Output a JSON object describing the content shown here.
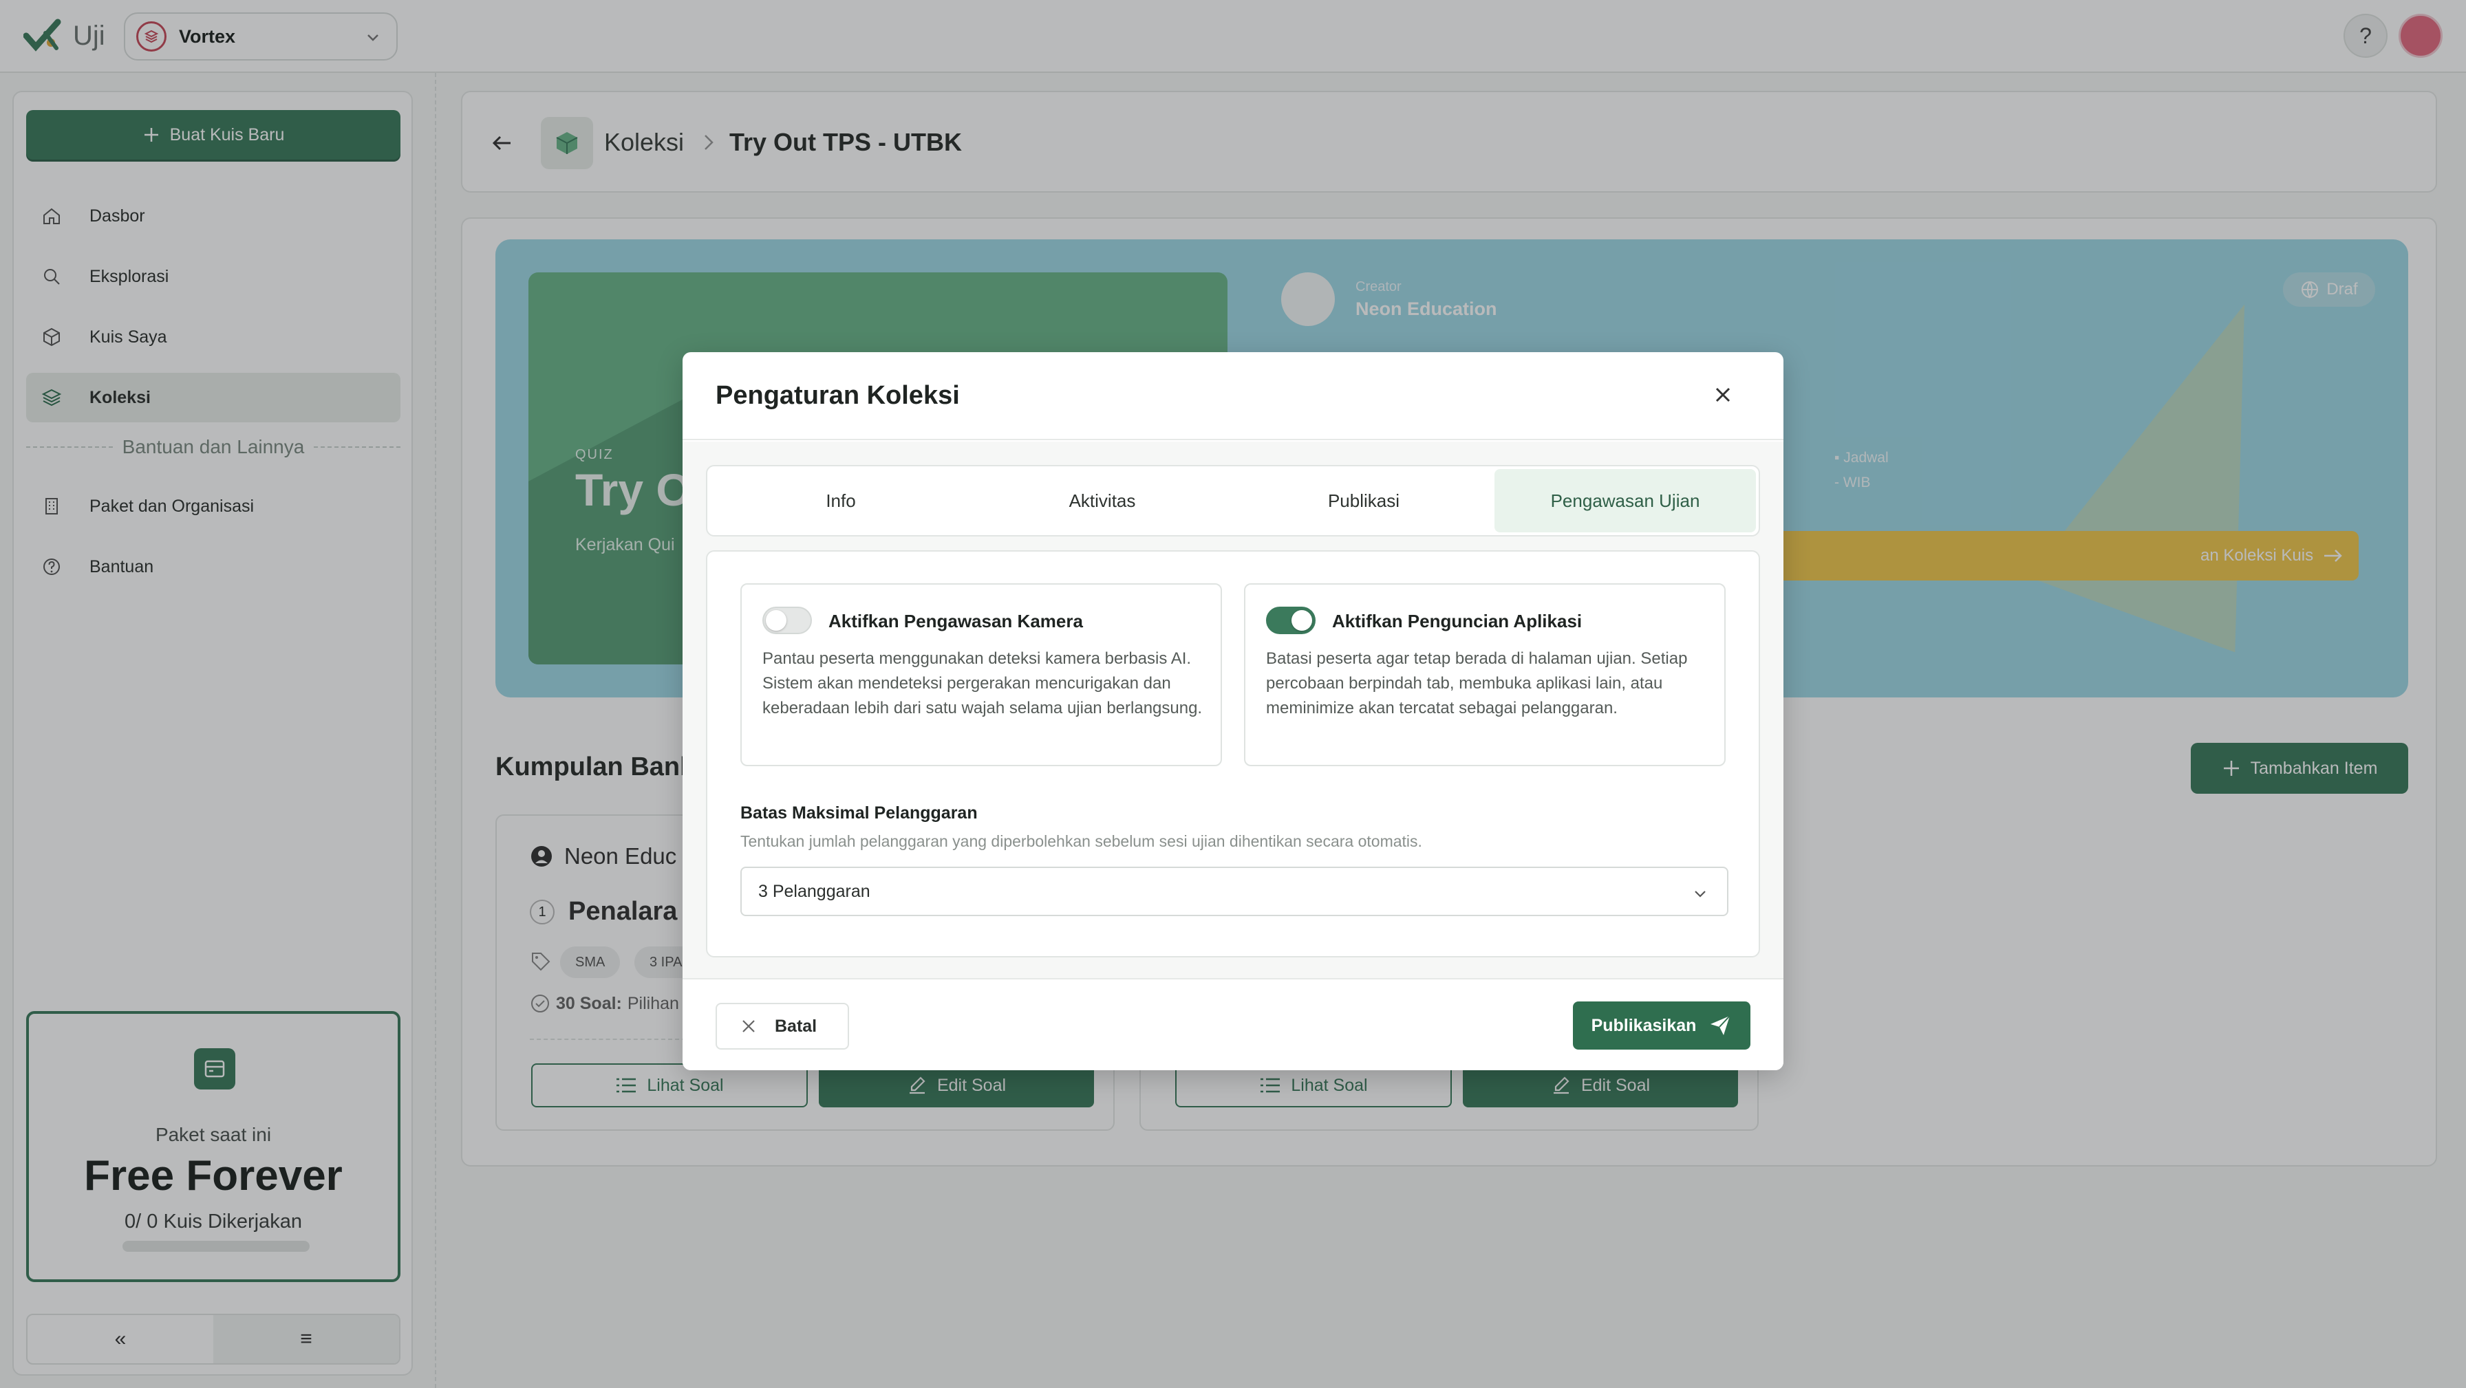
{
  "app": {
    "name": "Uji",
    "workspace": "Vortex"
  },
  "topbar": {
    "help_label": "?"
  },
  "sidebar": {
    "new_quiz": "Buat Kuis Baru",
    "items": [
      {
        "label": "Dasbor",
        "icon": "home-icon"
      },
      {
        "label": "Eksplorasi",
        "icon": "search-icon"
      },
      {
        "label": "Kuis Saya",
        "icon": "box-icon"
      },
      {
        "label": "Koleksi",
        "icon": "layers-icon",
        "active": true
      }
    ],
    "section_label": "Bantuan dan Lainnya",
    "extra_items": [
      {
        "label": "Paket dan Organisasi",
        "icon": "building-icon"
      },
      {
        "label": "Bantuan",
        "icon": "help-circle-icon"
      }
    ],
    "plan": {
      "label": "Paket saat ini",
      "name": "Free Forever",
      "count": "0/ 0 Kuis Dikerjakan",
      "progress": 0
    },
    "footer": {
      "collapse": "«",
      "menu": "≡"
    }
  },
  "breadcrumb": {
    "parent": "Koleksi",
    "current": "Try Out TPS - UTBK"
  },
  "hero": {
    "tag": "QUIZ",
    "title": "Try O",
    "subtitle": "Kerjakan Qui",
    "creator_label": "Creator",
    "creator_name": "Neon Education",
    "status": "Draf",
    "schedule_label": "Jadwal",
    "schedule_value": "- WIB",
    "cta": "an Koleksi Kuis"
  },
  "bank_section": {
    "title": "Kumpulan Bank",
    "add_label": "Tambahkan Item",
    "cards": [
      {
        "owner": "Neon Educ",
        "num": "1",
        "name": "Penalara",
        "tags": [
          "SMA",
          "3 IPA"
        ],
        "count": "30 Soal:",
        "type": "Pilihan",
        "view": "Lihat Soal",
        "edit": "Edit Soal"
      },
      {
        "view": "Lihat Soal",
        "edit": "Edit Soal"
      }
    ]
  },
  "modal": {
    "title": "Pengaturan Koleksi",
    "tabs": [
      "Info",
      "Aktivitas",
      "Publikasi",
      "Pengawasan Ujian"
    ],
    "active_tab": "Pengawasan Ujian",
    "camera": {
      "title": "Aktifkan Pengawasan Kamera",
      "enabled": false,
      "desc": "Pantau peserta menggunakan deteksi kamera berbasis AI. Sistem akan mendeteksi pergerakan mencurigakan dan keberadaan lebih dari satu wajah selama ujian berlangsung."
    },
    "lock": {
      "title": "Aktifkan Penguncian Aplikasi",
      "enabled": true,
      "desc": "Batasi peserta agar tetap berada di halaman ujian. Setiap percobaan berpindah tab, membuka aplikasi lain, atau meminimize akan tercatat sebagai pelanggaran."
    },
    "limit": {
      "label": "Batas Maksimal Pelanggaran",
      "help": "Tentukan jumlah pelanggaran yang diperbolehkan sebelum sesi ujian dihentikan secara otomatis.",
      "value": "3 Pelanggaran"
    },
    "cancel": "Batal",
    "publish": "Publikasikan"
  },
  "colors": {
    "primary": "#3b7a5c",
    "hero_bg": "#9fd8e6",
    "hero_card": "#6ab58a",
    "cta": "#f0c84e"
  }
}
